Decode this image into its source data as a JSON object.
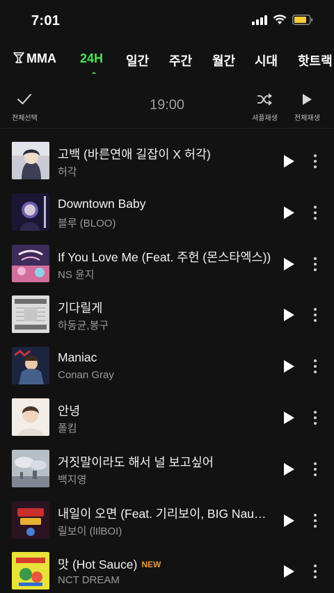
{
  "status_bar": {
    "time": "7:01"
  },
  "tabs": [
    {
      "label": "MMA"
    },
    {
      "label": "24H",
      "active": true
    },
    {
      "label": "일간"
    },
    {
      "label": "주간"
    },
    {
      "label": "월간"
    },
    {
      "label": "시대"
    },
    {
      "label": "핫트랙"
    }
  ],
  "toolbar": {
    "select_all_label": "전체선택",
    "timestamp": "19:00",
    "shuffle_label": "셔플재생",
    "play_all_label": "전체재생"
  },
  "songs": [
    {
      "title": "고백 (바른연애 길잡이 X 허각)",
      "artist": "허각",
      "art": "anime-portrait",
      "new": false
    },
    {
      "title": "Downtown Baby",
      "artist": "블루 (BLOO)",
      "art": "downtown-baby",
      "new": false
    },
    {
      "title": "If You Love Me (Feat. 주헌 (몬스타엑스))",
      "artist": "NS 윤지",
      "art": "if-you-love-me",
      "new": false
    },
    {
      "title": "기다릴게",
      "artist": "하동균,봉구",
      "art": "ha-dong-qn",
      "new": false
    },
    {
      "title": "Maniac",
      "artist": "Conan Gray",
      "art": "maniac",
      "new": false
    },
    {
      "title": "안녕",
      "artist": "폴킴",
      "art": "portrait",
      "new": false
    },
    {
      "title": "거짓말이라도 해서 널 보고싶어",
      "artist": "백지영",
      "art": "cloud-sky",
      "new": false
    },
    {
      "title": "내일이 오면 (Feat. 기리보이, BIG Naughty)",
      "artist": "릴보이 (lIlBOI)",
      "art": "show-me-the-money",
      "new": false
    },
    {
      "title": "맛 (Hot Sauce)",
      "artist": "NCT DREAM",
      "art": "hot-sauce",
      "new": true,
      "badge": "NEW"
    }
  ],
  "colors": {
    "accent": "#4be154",
    "background": "#121212",
    "new_badge": "#e79a3c"
  }
}
